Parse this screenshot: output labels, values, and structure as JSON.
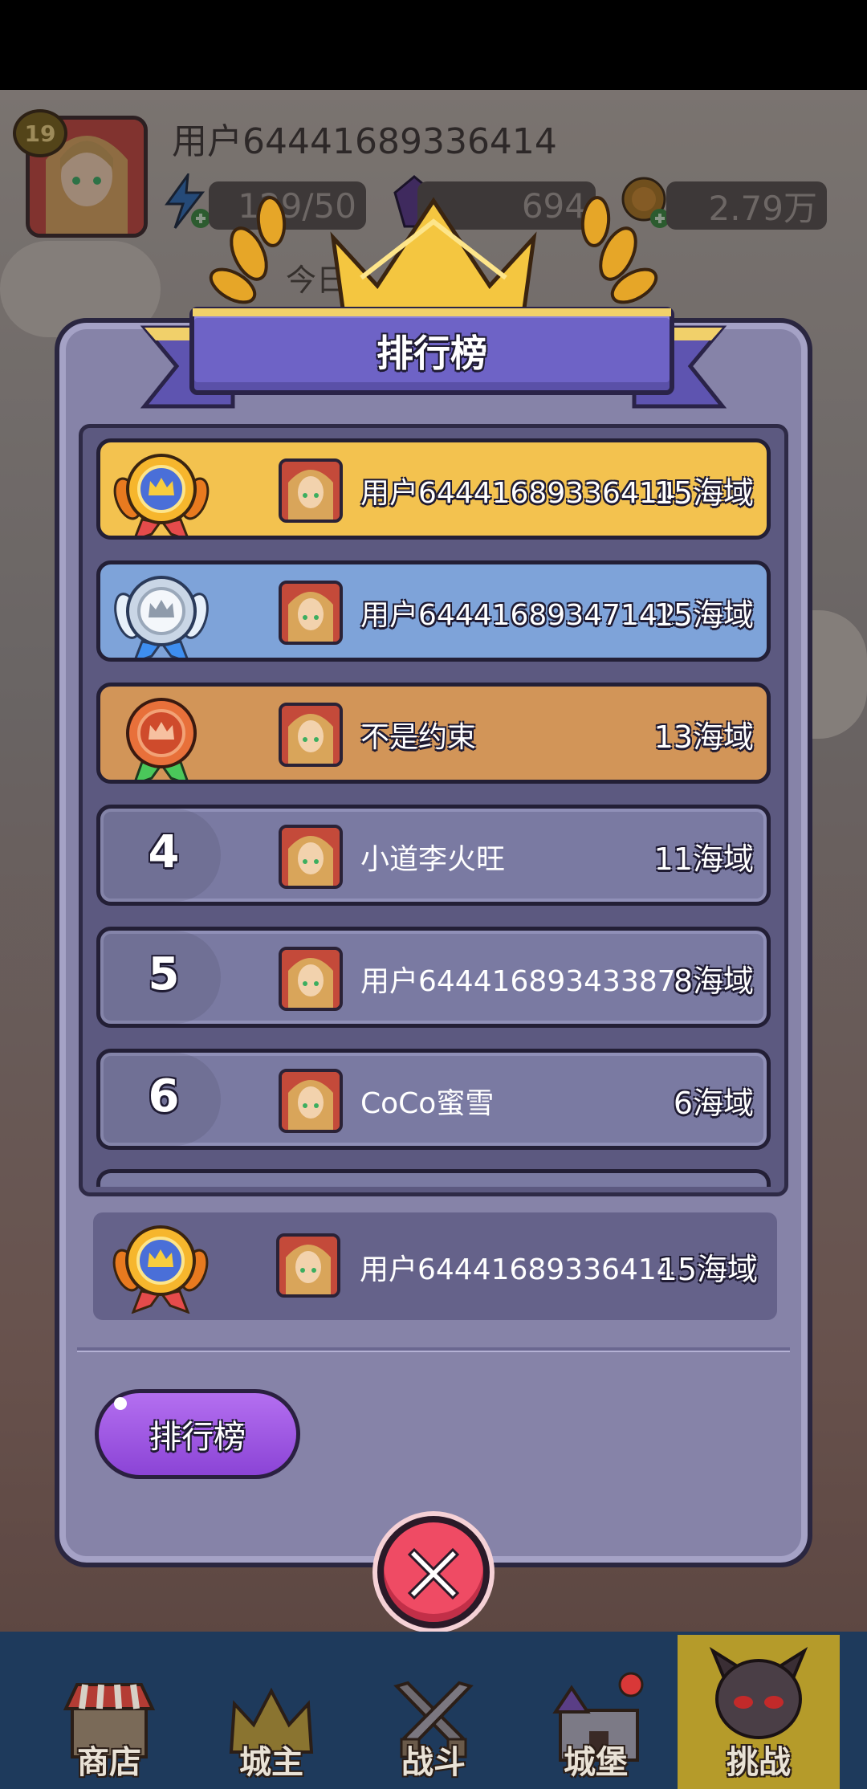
{
  "header": {
    "level": "19",
    "username": "用户64441689336414",
    "energy": "129/50",
    "gems": "694",
    "coins": "2.79万",
    "daily_partial": "今日"
  },
  "modal": {
    "title": "排行榜",
    "rows": [
      {
        "rank": "1",
        "medal": "gold",
        "name": "用户64441689336414",
        "score": "15海域"
      },
      {
        "rank": "2",
        "medal": "silver",
        "name": "用户64441689347142",
        "score": "15海域"
      },
      {
        "rank": "3",
        "medal": "bronze",
        "name": "不是约束",
        "score": "13海域"
      },
      {
        "rank": "4",
        "medal": "",
        "name": "小道李火旺",
        "score": "11海域"
      },
      {
        "rank": "5",
        "medal": "",
        "name": "用户64441689343387",
        "score": "8海域"
      },
      {
        "rank": "6",
        "medal": "",
        "name": "CoCo蜜雪",
        "score": "6海域"
      }
    ],
    "self": {
      "medal": "gold",
      "name": "用户64441689336414",
      "score": "15海域"
    },
    "rank_button": "排行榜"
  },
  "nav": {
    "shop": "商店",
    "lord": "城主",
    "battle": "战斗",
    "castle": "城堡",
    "challenge": "挑战"
  },
  "colors": {
    "gold_row": "#f3c24f",
    "silver_row": "#7ea3d9",
    "bronze_row": "#d29558",
    "normal_row": "#7a7aa2",
    "banner": "#6e63c6",
    "close": "#ef4b64",
    "rank_button": "#9b55e2"
  }
}
